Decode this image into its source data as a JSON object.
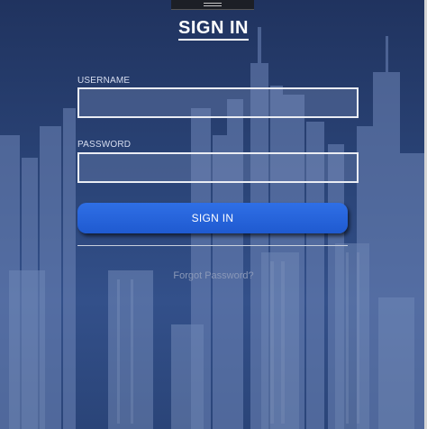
{
  "form": {
    "title": "SIGN IN",
    "username_label": "USERNAME",
    "username_value": "",
    "password_label": "PASSWORD",
    "password_value": "",
    "submit_label": "SIGN IN",
    "forgot_label": "Forgot Password?"
  },
  "colors": {
    "background": "#2a4174",
    "button": "#2566db",
    "field_border": "#e9ecf3",
    "text": "#ffffff",
    "link": "#8a98b8"
  }
}
